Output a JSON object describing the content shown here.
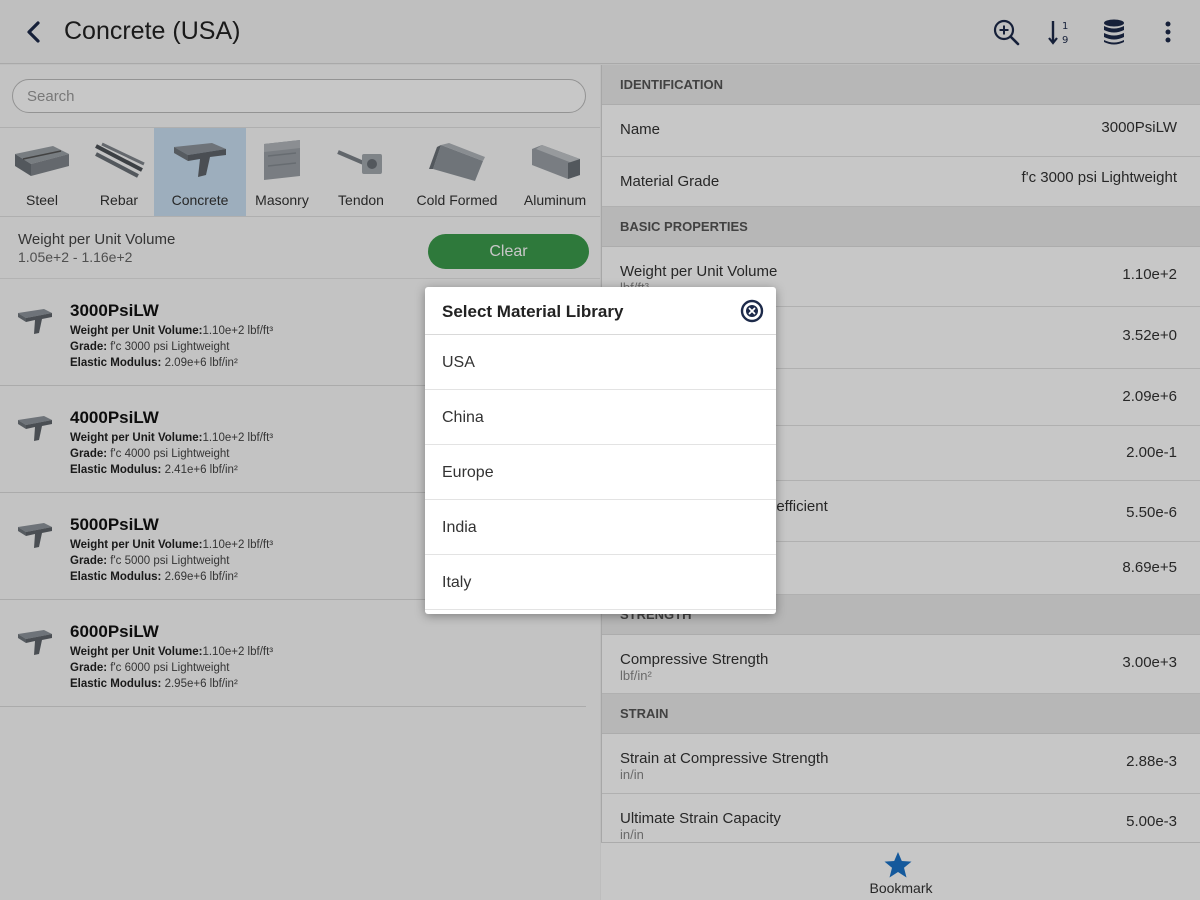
{
  "header": {
    "title": "Concrete (USA)"
  },
  "search": {
    "placeholder": "Search"
  },
  "categories": [
    {
      "label": "Steel"
    },
    {
      "label": "Rebar"
    },
    {
      "label": "Concrete",
      "active": true
    },
    {
      "label": "Masonry"
    },
    {
      "label": "Tendon"
    },
    {
      "label": "Cold Formed"
    },
    {
      "label": "Aluminum"
    }
  ],
  "filter": {
    "name": "Weight per Unit Volume",
    "range": "1.05e+2 - 1.16e+2",
    "clear_label": "Clear"
  },
  "materials": [
    {
      "name": "3000PsiLW",
      "wuv_label": "Weight per Unit Volume:",
      "wuv": "1.10e+2 lbf/ft³",
      "grade_label": "Grade:",
      "grade": "f'c 3000 psi Lightweight",
      "em_label": "Elastic Modulus:",
      "em": "2.09e+6 lbf/in²"
    },
    {
      "name": "4000PsiLW",
      "wuv_label": "Weight per Unit Volume:",
      "wuv": "1.10e+2 lbf/ft³",
      "grade_label": "Grade:",
      "grade": "f'c 4000 psi Lightweight",
      "em_label": "Elastic Modulus:",
      "em": "2.41e+6 lbf/in²"
    },
    {
      "name": "5000PsiLW",
      "wuv_label": "Weight per Unit Volume:",
      "wuv": "1.10e+2 lbf/ft³",
      "grade_label": "Grade:",
      "grade": "f'c 5000 psi Lightweight",
      "em_label": "Elastic Modulus:",
      "em": "2.69e+6 lbf/in²"
    },
    {
      "name": "6000PsiLW",
      "wuv_label": "Weight per Unit Volume:",
      "wuv": "1.10e+2 lbf/ft³",
      "grade_label": "Grade:",
      "grade": "f'c 6000 psi Lightweight",
      "em_label": "Elastic Modulus:",
      "em": "2.95e+6 lbf/in²"
    }
  ],
  "details": {
    "identification": {
      "title": "IDENTIFICATION",
      "rows": [
        {
          "key": "Name",
          "value": "3000PsiLW"
        },
        {
          "key": "Material Grade",
          "value": "f'c 3000 psi Lightweight"
        }
      ]
    },
    "basic": {
      "title": "BASIC PROPERTIES",
      "rows": [
        {
          "key": "Weight per Unit Volume",
          "unit": "lbf/ft³",
          "value": "1.10e+2"
        },
        {
          "key": "",
          "unit": "",
          "value": "3.52e+0",
          "key_tail": "e"
        },
        {
          "key": "",
          "unit": "",
          "value": "2.09e+6"
        },
        {
          "key": "",
          "unit": "",
          "value": "2.00e-1"
        },
        {
          "key": "",
          "unit": "",
          "value": "5.50e-6",
          "key_tail": "oefficient"
        },
        {
          "key": "",
          "unit": "",
          "value": "8.69e+5"
        }
      ]
    },
    "strength": {
      "title": "STRENGTH",
      "rows": [
        {
          "key": "Compressive Strength",
          "unit": "lbf/in²",
          "value": "3.00e+3"
        }
      ]
    },
    "strain": {
      "title": "STRAIN",
      "rows": [
        {
          "key": "Strain at Compressive Strength",
          "unit": "in/in",
          "value": "2.88e-3"
        },
        {
          "key": "Ultimate Strain Capacity",
          "unit": "in/in",
          "value": "5.00e-3"
        }
      ]
    }
  },
  "bottom": {
    "bookmark_label": "Bookmark"
  },
  "dialog": {
    "title": "Select Material Library",
    "options": [
      "USA",
      "China",
      "Europe",
      "India",
      "Italy"
    ]
  },
  "colors": {
    "accent_green": "#3c9c4c",
    "active_tab": "#c9dff2",
    "icon_navy": "#1d2a4a",
    "bookmark_blue": "#1a73c8"
  }
}
